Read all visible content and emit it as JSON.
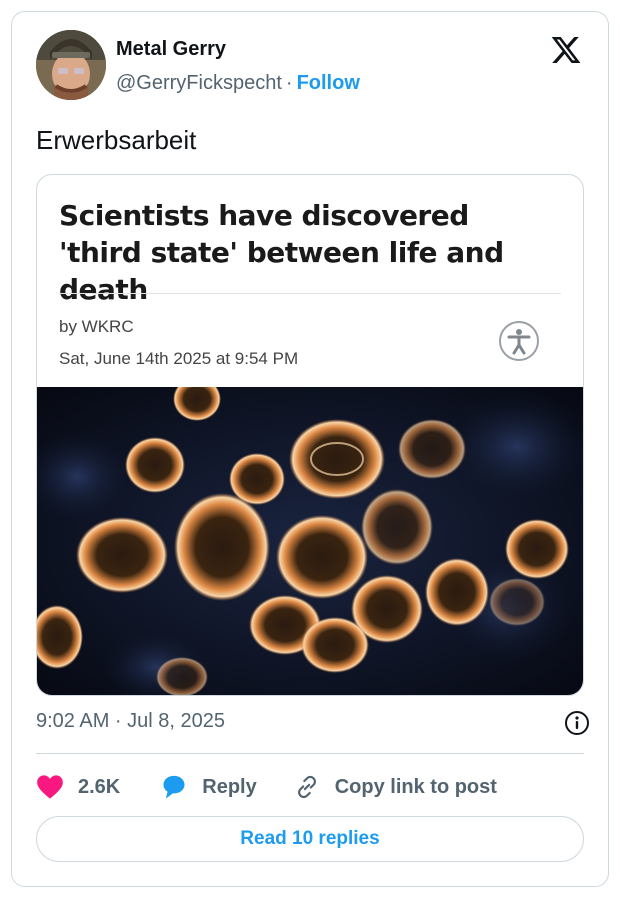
{
  "author": {
    "name": "Metal Gerry",
    "handle": "@GerryFickspecht",
    "separator": "·",
    "follow_label": "Follow"
  },
  "tweet": {
    "text": "Erwerbsarbeit",
    "timestamp": "9:02 AM · Jul 8, 2025"
  },
  "article": {
    "headline": "Scientists have discovered 'third state' between life and death",
    "byline": "by WKRC",
    "date": "Sat, June 14th 2025 at 9:54 PM"
  },
  "actions": {
    "likes_count": "2.6K",
    "reply_label": "Reply",
    "copy_link_label": "Copy link to post",
    "read_replies_label": "Read 10 replies"
  },
  "icons": {
    "platform_logo": "x-logo-icon",
    "like": "heart-icon",
    "reply": "speech-bubble-icon",
    "copy": "link-icon",
    "info": "info-icon",
    "accessibility": "accessibility-icon"
  },
  "colors": {
    "accent": "#1d9bf0",
    "like": "#f91880",
    "muted": "#536471",
    "border": "#cfd9de"
  }
}
